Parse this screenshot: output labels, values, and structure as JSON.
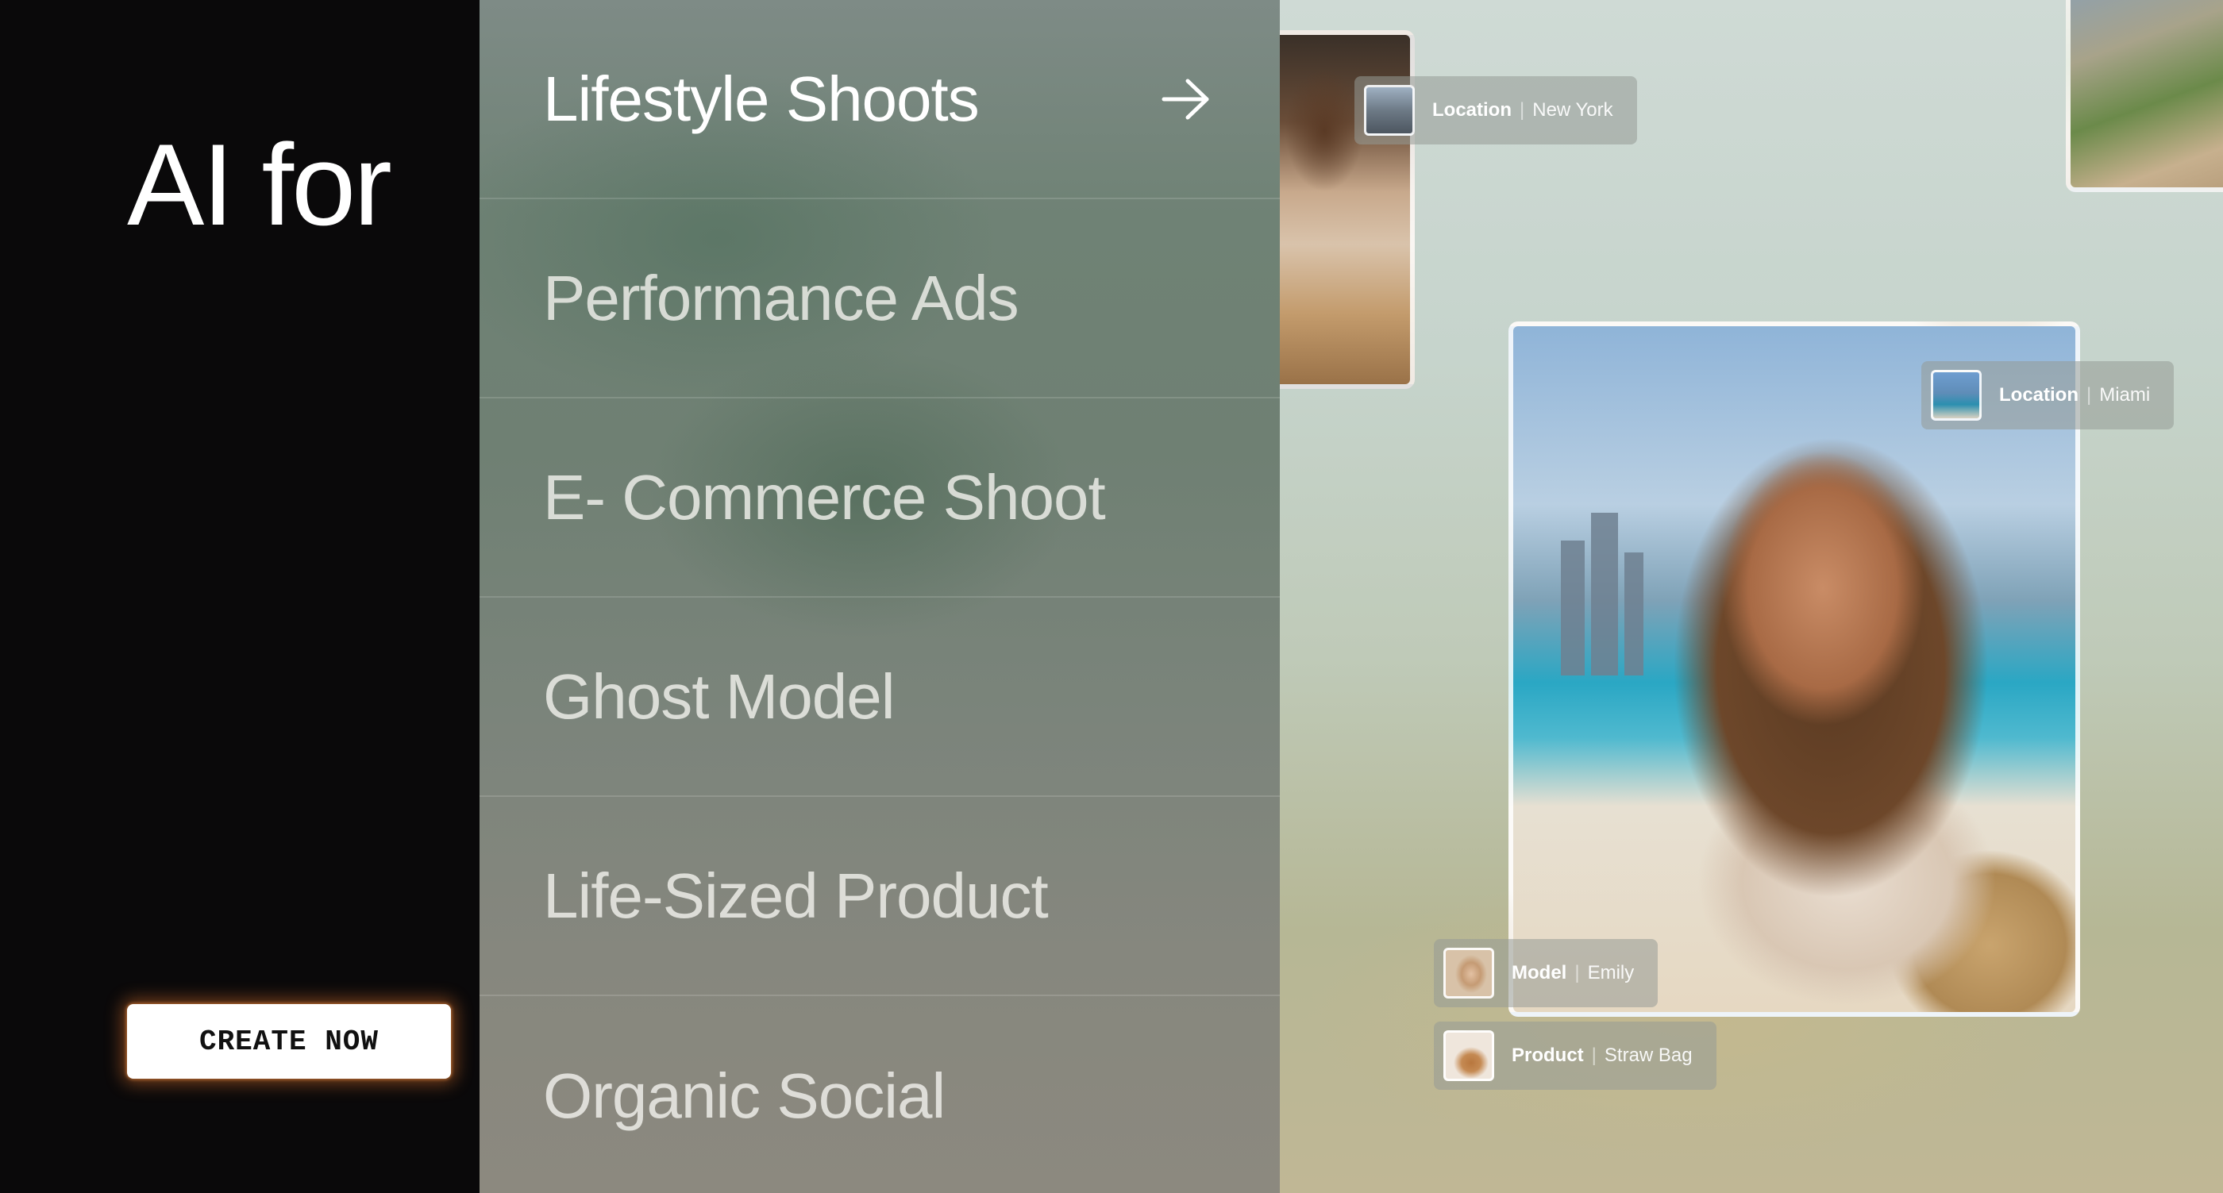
{
  "hero": {
    "headline": "AI for",
    "cta_label": "CREATE NOW"
  },
  "menu": {
    "items": [
      {
        "label": "Lifestyle Shoots",
        "active": true
      },
      {
        "label": "Performance Ads"
      },
      {
        "label": "E- Commerce Shoot"
      },
      {
        "label": "Ghost Model"
      },
      {
        "label": "Life-Sized Product"
      },
      {
        "label": "Organic Social"
      }
    ],
    "active_icon": "arrow-right-icon"
  },
  "tags": {
    "ny": {
      "key": "Location",
      "value": "New York"
    },
    "miami": {
      "key": "Location",
      "value": "Miami"
    },
    "model": {
      "key": "Model",
      "value": "Emily"
    },
    "product": {
      "key": "Product",
      "value": "Straw Bag"
    }
  },
  "colors": {
    "background": "#0a090a",
    "cta_bg": "#ffffff",
    "cta_glow": "#ff8232",
    "menu_text": "#f0f0eb"
  }
}
